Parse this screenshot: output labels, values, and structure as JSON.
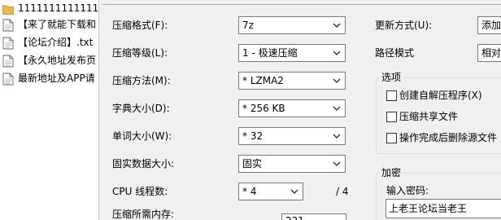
{
  "files": [
    {
      "name": "1111111111111",
      "icon": "folder-icon"
    },
    {
      "name": "【来了就能下载和",
      "icon": "text-file-icon"
    },
    {
      "name": "【论坛介绍】.txt",
      "icon": "text-file-icon"
    },
    {
      "name": "【永久地址发布页",
      "icon": "text-file-icon"
    },
    {
      "name": "最新地址及APP请",
      "icon": "text-file-icon"
    }
  ],
  "form": {
    "format_label": "压缩格式(F):",
    "format_value": "7z",
    "level_label": "压缩等级(L):",
    "level_value": "1 - 极速压缩",
    "method_label": "压缩方法(M):",
    "method_value": "* LZMA2",
    "dict_label": "字典大小(D):",
    "dict_value": "* 256 KB",
    "word_label": "单词大小(W):",
    "word_value": "* 32",
    "solid_label": "固实数据大小:",
    "solid_value": "固实",
    "threads_label": "CPU 线程数:",
    "threads_value": "* 4",
    "threads_total": "/ 4",
    "memory_label": "压缩所需内存:",
    "memory_value_partial": "221"
  },
  "right": {
    "update_label": "更新方式(U):",
    "update_value": "添加",
    "path_label": "路径模式",
    "path_value": "相对",
    "options_title": "选项",
    "opt_sfx": "创建自解压程序(X)",
    "opt_shared": "压缩共享文件",
    "opt_delete": "操作完成后删除源文件",
    "encrypt_title": "加密",
    "password_label": "输入密码:",
    "password_value": "上老王论坛当老王"
  },
  "colors": {
    "window_bg": "#f0f0f0",
    "folder": "#e8b84a",
    "border": "#7a7a7a"
  }
}
